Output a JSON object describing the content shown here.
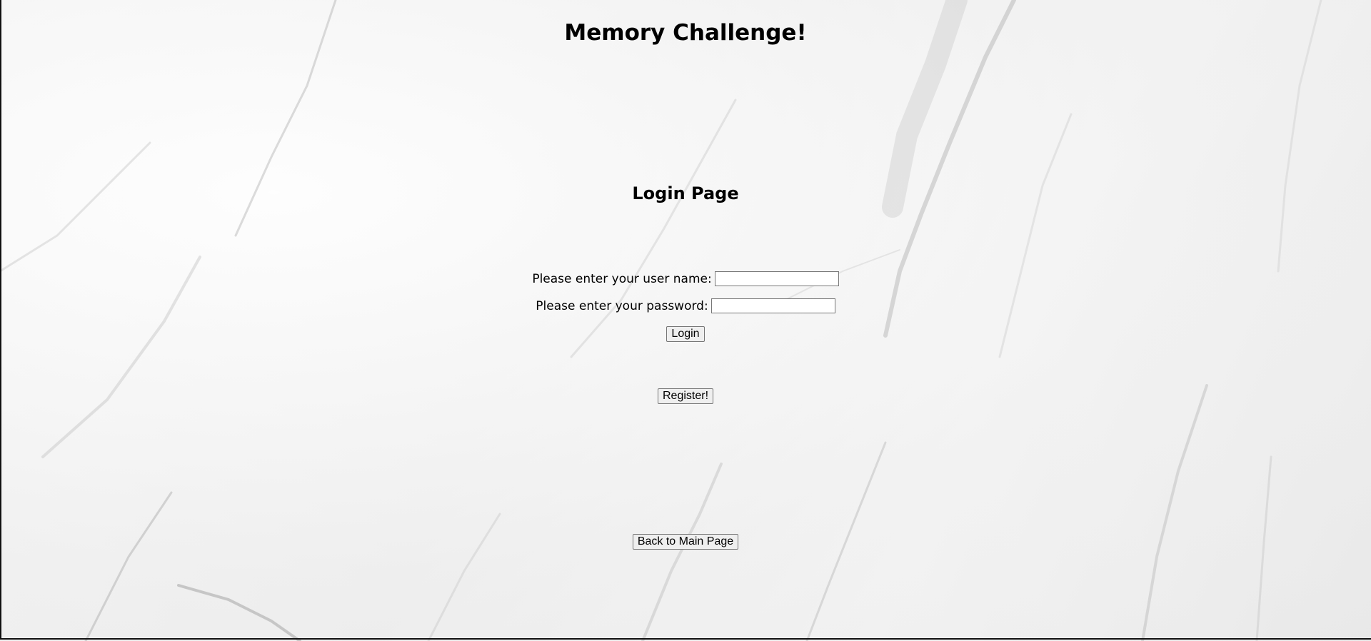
{
  "header": {
    "title": "Memory Challenge!"
  },
  "main": {
    "subtitle": "Login Page",
    "username": {
      "label": "Please enter your user name:",
      "value": "",
      "placeholder": ""
    },
    "password": {
      "label": "Please enter your password:",
      "value": "",
      "placeholder": ""
    },
    "login_label": "Login",
    "register_label": "Register!",
    "back_label": "Back to Main Page"
  },
  "colors": {
    "background": "#f0f0f0",
    "text": "#000000",
    "border": "#111111"
  }
}
